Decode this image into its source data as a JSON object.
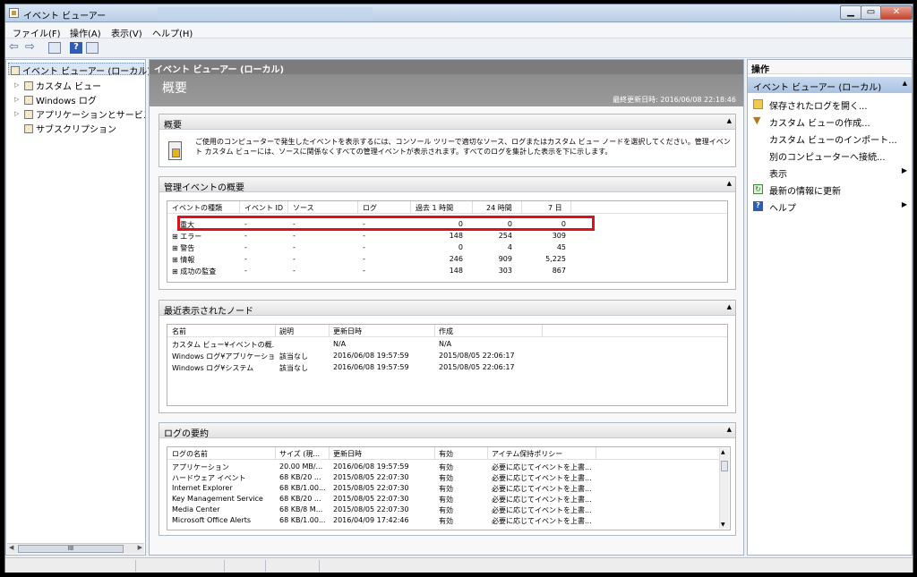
{
  "window": {
    "title": "イベント ビューアー"
  },
  "menu": [
    "ファイル(F)",
    "操作(A)",
    "表示(V)",
    "ヘルプ(H)"
  ],
  "tree": {
    "root": "イベント ビューアー (ローカル)",
    "items": [
      "カスタム ビュー",
      "Windows ログ",
      "アプリケーションとサービス ログ",
      "サブスクリプション"
    ],
    "scroll_label": "III"
  },
  "center": {
    "title": "イベント ビューアー (ローカル)",
    "heading": "概要",
    "last_updated": "最終更新日時: 2016/06/08 22:18:46",
    "overview": {
      "header": "概要",
      "text": "ご使用のコンピューターで発生したイベントを表示するには、コンソール ツリーで適切なソース、ログまたはカスタム ビュー ノードを選択してください。管理イベント カスタム ビューには、ソースに関係なくすべての管理イベントが表示されます。すべてのログを集計した表示を下に示します。"
    },
    "admin": {
      "header": "管理イベントの概要",
      "columns": [
        "イベントの種類",
        "イベント ID",
        "ソース",
        "ログ",
        "過去 1 時間",
        "24 時間",
        "7 日"
      ],
      "rows": [
        {
          "type": "重大",
          "id": "-",
          "source": "-",
          "log": "-",
          "h1": "0",
          "h24": "0",
          "d7": "0"
        },
        {
          "type": "⊞ エラー",
          "id": "-",
          "source": "-",
          "log": "-",
          "h1": "148",
          "h24": "254",
          "d7": "309"
        },
        {
          "type": "⊞ 警告",
          "id": "-",
          "source": "-",
          "log": "-",
          "h1": "0",
          "h24": "4",
          "d7": "45"
        },
        {
          "type": "⊞ 情報",
          "id": "-",
          "source": "-",
          "log": "-",
          "h1": "246",
          "h24": "909",
          "d7": "5,225"
        },
        {
          "type": "⊞ 成功の監査",
          "id": "-",
          "source": "-",
          "log": "-",
          "h1": "148",
          "h24": "303",
          "d7": "867"
        }
      ]
    },
    "recent": {
      "header": "最近表示されたノード",
      "columns": [
        "名前",
        "説明",
        "更新日時",
        "作成"
      ],
      "rows": [
        {
          "name": "カスタム ビュー¥イベントの概...",
          "desc": "",
          "updated": "N/A",
          "created": "N/A"
        },
        {
          "name": "Windows ログ¥アプリケーション",
          "desc": "該当なし",
          "updated": "2016/06/08 19:57:59",
          "created": "2015/08/05 22:06:17"
        },
        {
          "name": "Windows ログ¥システム",
          "desc": "該当なし",
          "updated": "2016/06/08 19:57:59",
          "created": "2015/08/05 22:06:17"
        }
      ]
    },
    "logs": {
      "header": "ログの要約",
      "columns": [
        "ログの名前",
        "サイズ (現...",
        "更新日時",
        "有効",
        "アイテム保持ポリシー"
      ],
      "rows": [
        {
          "name": "アプリケーション",
          "size": "20.00 MB/...",
          "updated": "2016/06/08 19:57:59",
          "enabled": "有効",
          "policy": "必要に応じてイベントを上書..."
        },
        {
          "name": "ハードウェア イベント",
          "size": "68 KB/20 ...",
          "updated": "2015/08/05 22:07:30",
          "enabled": "有効",
          "policy": "必要に応じてイベントを上書..."
        },
        {
          "name": "Internet Explorer",
          "size": "68 KB/1.00...",
          "updated": "2015/08/05 22:07:30",
          "enabled": "有効",
          "policy": "必要に応じてイベントを上書..."
        },
        {
          "name": "Key Management Service",
          "size": "68 KB/20 ...",
          "updated": "2015/08/05 22:07:30",
          "enabled": "有効",
          "policy": "必要に応じてイベントを上書..."
        },
        {
          "name": "Media Center",
          "size": "68 KB/8 M...",
          "updated": "2015/08/05 22:07:30",
          "enabled": "有効",
          "policy": "必要に応じてイベントを上書..."
        },
        {
          "name": "Microsoft Office Alerts",
          "size": "68 KB/1.00...",
          "updated": "2016/04/09 17:42:46",
          "enabled": "有効",
          "policy": "必要に応じてイベントを上書..."
        }
      ]
    }
  },
  "actions": {
    "header": "操作",
    "section": "イベント ビューアー (ローカル)",
    "items": [
      {
        "label": "保存されたログを開く...",
        "icon": "folder-open-icon",
        "submenu": false
      },
      {
        "label": "カスタム ビューの作成...",
        "icon": "filter-icon",
        "submenu": false
      },
      {
        "label": "カスタム ビューのインポート...",
        "icon": "",
        "submenu": false
      },
      {
        "label": "別のコンピューターへ接続...",
        "icon": "",
        "submenu": false
      },
      {
        "label": "表示",
        "icon": "",
        "submenu": true
      },
      {
        "label": "最新の情報に更新",
        "icon": "refresh-icon",
        "submenu": false
      },
      {
        "label": "ヘルプ",
        "icon": "help-icon",
        "submenu": true
      }
    ]
  },
  "colors": {
    "highlight_box": "#e0101a",
    "header_gray": "#7c7c7c",
    "action_section": "#b9cfea"
  }
}
